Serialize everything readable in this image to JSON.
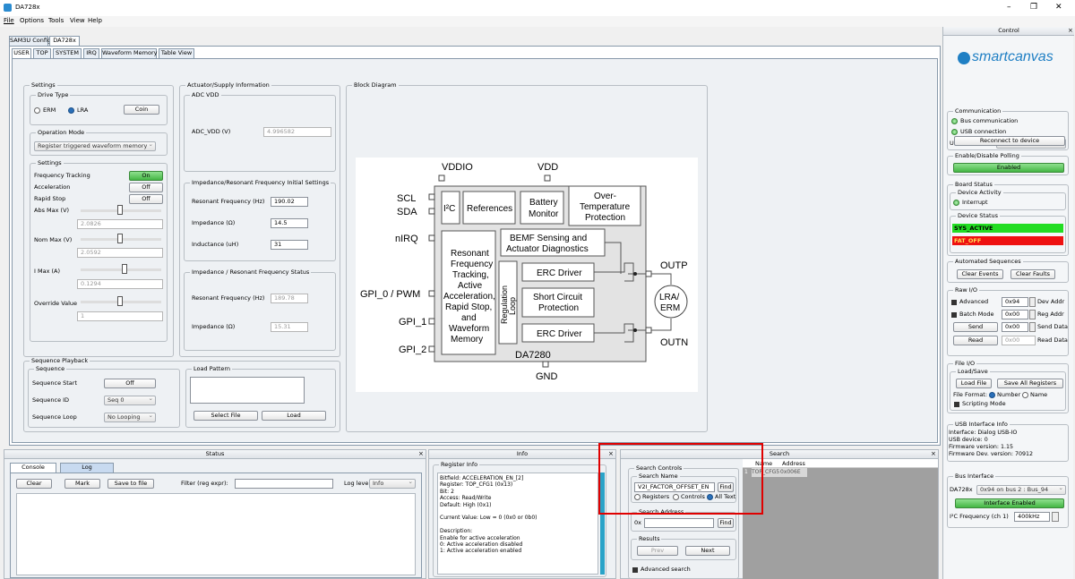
{
  "window": {
    "title": "DA728x",
    "min": "–",
    "max": "❐",
    "close": "✕"
  },
  "menu": [
    "File",
    "Options",
    "Tools",
    "View",
    "Help"
  ],
  "top_tabs": [
    "SAM3U Config",
    "DA728x"
  ],
  "sub_tabs": [
    "USER",
    "TOP",
    "SYSTEM",
    "IRQ",
    "Waveform Memory",
    "Table View"
  ],
  "settings": {
    "legend": "Settings",
    "drive_type": {
      "legend": "Drive Type",
      "erm": "ERM",
      "lra": "LRA",
      "coin": "Coin"
    },
    "operation_mode": {
      "legend": "Operation Mode",
      "value": "Register triggered waveform memory"
    },
    "settings2": {
      "legend": "Settings",
      "freq_tracking": "Frequency Tracking",
      "freq_tracking_val": "On",
      "acceleration": "Acceleration",
      "acceleration_val": "Off",
      "rapid_stop": "Rapid Stop",
      "rapid_stop_val": "Off",
      "abs_max": "Abs Max (V)",
      "abs_max_val": "2.0826",
      "nom_max": "Nom Max (V)",
      "nom_max_val": "2.0592",
      "imax": "I Max (A)",
      "imax_val": "0.1294",
      "override": "Override Value",
      "override_val": "1"
    }
  },
  "actuator": {
    "legend": "Actuator/Supply Information",
    "adc_vdd": {
      "legend": "ADC VDD",
      "label": "ADC_VDD (V)",
      "value": "4.996582"
    },
    "impedance_init": {
      "legend": "Impedance/Resonant Frequency Initial Settings",
      "res_freq": "Resonant Frequency (Hz)",
      "res_freq_val": "190.02",
      "impedance": "Impedance (Ω)",
      "impedance_val": "14.5",
      "inductance": "Inductance (uH)",
      "inductance_val": "31"
    },
    "impedance_status": {
      "legend": "Impedance / Resonant Frequency Status",
      "res_freq": "Resonant Frequency (Hz)",
      "res_freq_val": "189.78",
      "impedance": "Impedance (Ω)",
      "impedance_val": "15.31"
    }
  },
  "block_diagram": {
    "legend": "Block Diagram",
    "pins_left": [
      "SCL",
      "SDA",
      "nIRQ",
      "GPI_0 / PWM",
      "GPI_1",
      "GPI_2"
    ],
    "pins_top": [
      "VDDIO",
      "VDD"
    ],
    "pin_bottom": "GND",
    "pins_right": [
      "OUTP",
      "OUTN"
    ],
    "i2c": "I²C",
    "references": "References",
    "battery_monitor": [
      "Battery",
      "Monitor"
    ],
    "overtemp": [
      "Over-",
      "Temperature",
      "Protection"
    ],
    "bemf": [
      "BEMF Sensing and",
      "Actuator Diagnostics"
    ],
    "resonant": [
      "Resonant",
      "Frequency",
      "Tracking,",
      "Active",
      "Acceleration,",
      "Rapid Stop,",
      "and",
      "Waveform",
      "Memory"
    ],
    "regulation_loop": [
      "Regulation",
      "Loop"
    ],
    "erc_driver": "ERC Driver",
    "short_circuit": [
      "Short Circuit",
      "Protection"
    ],
    "chip": "DA7280",
    "actuator": [
      "LRA/",
      "ERM"
    ]
  },
  "sequence": {
    "legend": "Sequence Playback",
    "seq_legend": "Sequence",
    "start": "Sequence Start",
    "start_val": "Off",
    "id": "Sequence ID",
    "id_val": "Seq 0",
    "loop": "Sequence Loop",
    "loop_val": "No Looping",
    "load_pattern": "Load Pattern",
    "select_file": "Select File",
    "load": "Load"
  },
  "status": {
    "title": "Status",
    "tabs": [
      "Console",
      "Log"
    ],
    "clear": "Clear",
    "mark": "Mark",
    "save": "Save to file",
    "filter_label": "Filter (reg expr):",
    "filter_val": "",
    "log_level_label": "Log level:",
    "log_level_val": "Info"
  },
  "info": {
    "title": "Info",
    "legend": "Register Info",
    "lines": [
      "Bitfield: ACCELERATION_EN_[2]",
      "Register: TOP_CFG1 (0x13)",
      "Bit: 2",
      "Access: Read/Write",
      "Default: High (0x1)",
      "",
      "Current Value: Low = 0 (0x0 or 0b0)",
      "",
      "Description:",
      "Enable for active acceleration",
      "0: Active acceleration disabled",
      "1: Active acceleration enabled"
    ]
  },
  "search": {
    "title": "Search",
    "controls_legend": "Search Controls",
    "name_legend": "Search Name",
    "name_val": "V2I_FACTOR_OFFSET_EN",
    "find": "Find",
    "opt_registers": "Registers",
    "opt_controls": "Controls",
    "opt_alltext": "All Text",
    "address_legend": "Search Address",
    "address_prefix": "0x",
    "results_legend": "Results",
    "prev": "Prev",
    "next": "Next",
    "advanced": "Advanced search",
    "col_name": "Name",
    "col_address": "Address",
    "row_index": "1",
    "row_name": "TOP_CFG5",
    "row_address": "0x006E"
  },
  "control": {
    "title": "Control",
    "logo": "smartcanvas",
    "communication": "Communication",
    "bus_comm": "Bus communication",
    "usb_conn": "USB connection",
    "usb_device": "USB device",
    "usb_device_val": "0--->dev0",
    "reconnect": "Reconnect to device",
    "polling_legend": "Enable/Disable Polling",
    "polling_val": "Enabled",
    "board_status": "Board Status",
    "device_activity": "Device Activity",
    "interrupt": "Interrupt",
    "device_status": "Device Status",
    "status1": "SYS_ACTIVE",
    "status2": "FAT_OFF",
    "auto_seq": "Automated Sequences",
    "clear_events": "Clear Events",
    "clear_faults": "Clear Faults",
    "raw_io": "Raw I/O",
    "advanced": "Advanced",
    "advanced_val": "0x94",
    "dev_addr": "Dev Addr",
    "batch_mode": "Batch Mode",
    "batch_val": "0x00",
    "reg_addr": "Reg Addr",
    "send": "Send",
    "send_val": "0x00",
    "send_data": "Send Data",
    "read": "Read",
    "read_val": "0x00",
    "read_data": "Read Data",
    "file_io": "File I/O",
    "load_save": "Load/Save",
    "load_file": "Load File",
    "save_all": "Save All Registers",
    "file_format": "File Format:",
    "fmt_number": "Number",
    "fmt_name": "Name",
    "scripting": "Scripting Mode",
    "usb_info": "USB Interface Info",
    "usb_info_lines": [
      "Interface: Dialog USB-IO",
      "USB device: 0",
      "Firmware version: 1.15",
      "Firmware Dev. version: 70912"
    ],
    "bus_iface": "Bus Interface",
    "da728x": "DA728x",
    "bus_val": "0x94 on bus 2 : Bus_94",
    "iface_enabled": "Interface Enabled",
    "i2c_freq": "I²C Frequency (ch 1)",
    "i2c_freq_val": "400kHz"
  },
  "colors": {
    "accent_green": "#44b644",
    "status_active": "#22dd22",
    "status_fault": "#ee1111",
    "highlight_box": "#e00000",
    "logo_blue": "#1f7fc4"
  }
}
